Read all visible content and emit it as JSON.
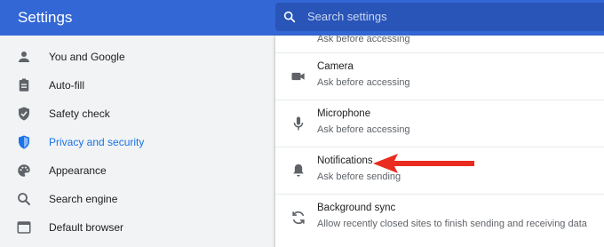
{
  "header": {
    "title": "Settings",
    "search_placeholder": "Search settings",
    "icon": "search-icon"
  },
  "sidebar": {
    "items": [
      {
        "label": "You and Google",
        "icon": "person-icon",
        "active": false
      },
      {
        "label": "Auto-fill",
        "icon": "clipboard-icon",
        "active": false
      },
      {
        "label": "Safety check",
        "icon": "shield-check-icon",
        "active": false
      },
      {
        "label": "Privacy and security",
        "icon": "shield-icon",
        "active": true
      },
      {
        "label": "Appearance",
        "icon": "palette-icon",
        "active": false
      },
      {
        "label": "Search engine",
        "icon": "search-icon",
        "active": false
      },
      {
        "label": "Default browser",
        "icon": "browser-window-icon",
        "active": false
      }
    ]
  },
  "main": {
    "partial_row": {
      "subtitle": "Ask before accessing"
    },
    "rows": [
      {
        "title": "Camera",
        "subtitle": "Ask before accessing",
        "icon": "camera-icon"
      },
      {
        "title": "Microphone",
        "subtitle": "Ask before accessing",
        "icon": "microphone-icon"
      },
      {
        "title": "Notifications",
        "subtitle": "Ask before sending",
        "icon": "bell-icon"
      },
      {
        "title": "Background sync",
        "subtitle": "Allow recently closed sites to finish sending and receiving data",
        "icon": "sync-icon"
      }
    ]
  },
  "colors": {
    "header": "#3367d6",
    "accent": "#1a73e8",
    "arrow": "#ea2b1f"
  }
}
